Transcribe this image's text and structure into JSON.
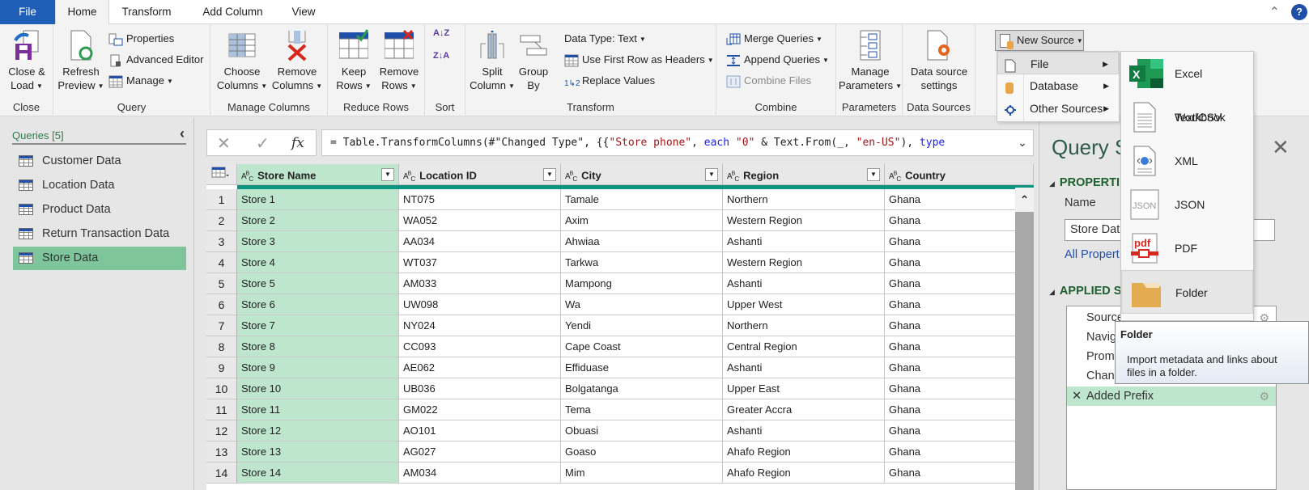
{
  "tabs": [
    {
      "label": "File"
    },
    {
      "label": "Home"
    },
    {
      "label": "Transform"
    },
    {
      "label": "Add Column"
    },
    {
      "label": "View"
    }
  ],
  "ribbon": {
    "close": {
      "group": "Close",
      "close_load": "Close &",
      "close_load2": "Load"
    },
    "query": {
      "group": "Query",
      "refresh": "Refresh",
      "refresh2": "Preview",
      "properties": "Properties",
      "advanced_editor": "Advanced Editor",
      "manage": "Manage"
    },
    "manage_columns": {
      "group": "Manage Columns",
      "choose": "Choose",
      "choose2": "Columns",
      "remove": "Remove",
      "remove2": "Columns"
    },
    "reduce_rows": {
      "group": "Reduce Rows",
      "keep": "Keep",
      "keep2": "Rows",
      "remove": "Remove",
      "remove2": "Rows"
    },
    "sort": {
      "group": "Sort",
      "asc": "A↓Z",
      "desc": "Z↓A"
    },
    "transform": {
      "group": "Transform",
      "split": "Split",
      "split2": "Column",
      "group_by": "Group",
      "group_by2": "By",
      "data_type": "Data Type: Text",
      "first_row": "Use First Row as Headers",
      "replace": "Replace Values"
    },
    "combine": {
      "group": "Combine",
      "merge": "Merge Queries",
      "append": "Append Queries",
      "combine_files": "Combine Files"
    },
    "parameters": {
      "group": "Parameters",
      "manage": "Manage",
      "manage2": "Parameters"
    },
    "data_sources": {
      "group": "Data Sources",
      "settings": "Data source",
      "settings2": "settings"
    },
    "new_source": {
      "label": "New Source"
    }
  },
  "new_source_menu": {
    "items": [
      {
        "label": "File"
      },
      {
        "label": "Database"
      },
      {
        "label": "Other Sources"
      }
    ],
    "file_submenu": [
      {
        "label": "Excel Workbook"
      },
      {
        "label": "Text/CSV"
      },
      {
        "label": "XML"
      },
      {
        "label": "JSON"
      },
      {
        "label": "PDF"
      },
      {
        "label": "Folder"
      }
    ]
  },
  "tooltip": {
    "title": "Folder",
    "description": "Import metadata and links about files in a folder."
  },
  "queries": {
    "title": "Queries [5]",
    "items": [
      {
        "label": "Customer Data"
      },
      {
        "label": "Location Data"
      },
      {
        "label": "Product Data"
      },
      {
        "label": "Return Transaction Data"
      },
      {
        "label": "Store Data"
      }
    ],
    "selected": "Store Data"
  },
  "formula": {
    "p1": "= Table.TransformColumns(#\"Changed Type\", {{",
    "s1": "\"Store phone\"",
    "p2": ", ",
    "k1": "each",
    "p3": " ",
    "s2": "\"0\"",
    "p4": " & Text.From(_, ",
    "s3": "\"en-US\"",
    "p5": "), ",
    "k2": "type"
  },
  "table": {
    "type_badge": "ABC",
    "columns": [
      "Store Name",
      "Location ID",
      "City",
      "Region",
      "Country"
    ],
    "rows": [
      [
        "1",
        "Store 1",
        "NT075",
        "Tamale",
        "Northern",
        "Ghana"
      ],
      [
        "2",
        "Store 2",
        "WA052",
        "Axim",
        "Western Region",
        "Ghana"
      ],
      [
        "3",
        "Store 3",
        "AA034",
        "Ahwiaa",
        "Ashanti",
        "Ghana"
      ],
      [
        "4",
        "Store 4",
        "WT037",
        "Tarkwa",
        "Western Region",
        "Ghana"
      ],
      [
        "5",
        "Store 5",
        "AM033",
        "Mampong",
        "Ashanti",
        "Ghana"
      ],
      [
        "6",
        "Store 6",
        "UW098",
        "Wa",
        "Upper West",
        "Ghana"
      ],
      [
        "7",
        "Store 7",
        "NY024",
        "Yendi",
        "Northern",
        "Ghana"
      ],
      [
        "8",
        "Store 8",
        "CC093",
        "Cape Coast",
        "Central Region",
        "Ghana"
      ],
      [
        "9",
        "Store 9",
        "AE062",
        "Effiduase",
        "Ashanti",
        "Ghana"
      ],
      [
        "10",
        "Store 10",
        "UB036",
        "Bolgatanga",
        "Upper East",
        "Ghana"
      ],
      [
        "11",
        "Store 11",
        "GM022",
        "Tema",
        "Greater Accra",
        "Ghana"
      ],
      [
        "12",
        "Store 12",
        "AO101",
        "Obuasi",
        "Ashanti",
        "Ghana"
      ],
      [
        "13",
        "Store 13",
        "AG027",
        "Goaso",
        "Ahafo Region",
        "Ghana"
      ],
      [
        "14",
        "Store 14",
        "AM034",
        "Mim",
        "Ahafo Region",
        "Ghana"
      ]
    ]
  },
  "settings": {
    "title": "Query S",
    "properties_heading": "PROPERTI",
    "name_label": "Name",
    "name_value": "Store Data",
    "all_properties": "All Propert",
    "applied_heading": "APPLIED S",
    "steps": [
      {
        "label": "Source"
      },
      {
        "label": "Navig"
      },
      {
        "label": "Prom"
      },
      {
        "label": "Chan"
      },
      {
        "label": "Added Prefix"
      }
    ]
  },
  "colors": {
    "accent_green": "#7fc59c",
    "selected_column": "#bde6cc",
    "teal_bar": "#0b9480",
    "file_tab": "#1f5fb8"
  }
}
